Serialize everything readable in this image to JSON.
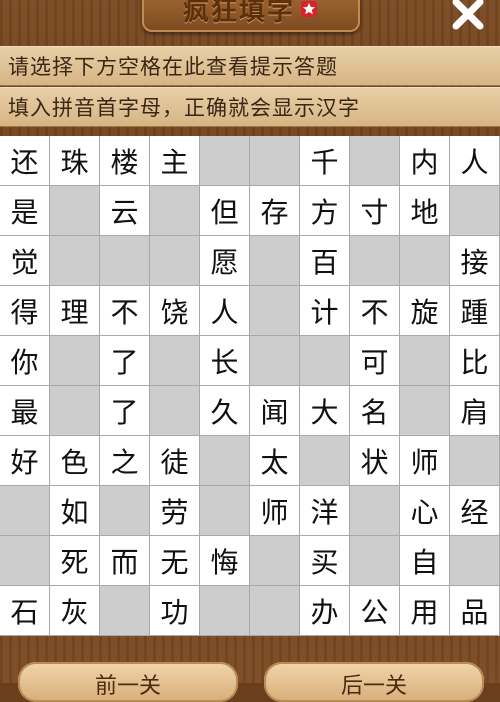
{
  "header": {
    "title": "疯狂填字",
    "close_symbol": "✕"
  },
  "hints": [
    "请选择下方空格在此查看提示答题",
    "填入拼音首字母，正确就会显示汉字"
  ],
  "grid": [
    [
      "还",
      "珠",
      "楼",
      "主",
      "",
      "",
      "千",
      "",
      "内",
      "人"
    ],
    [
      "是",
      "",
      "云",
      "",
      "但",
      "存",
      "方",
      "寸",
      "地",
      ""
    ],
    [
      "觉",
      "",
      "",
      "",
      "愿",
      "",
      "百",
      "",
      "",
      "接"
    ],
    [
      "得",
      "理",
      "不",
      "饶",
      "人",
      "",
      "计",
      "不",
      "旋",
      "踵"
    ],
    [
      "你",
      "",
      "了",
      "",
      "长",
      "",
      "",
      "可",
      "",
      "比"
    ],
    [
      "最",
      "",
      "了",
      "",
      "久",
      "闻",
      "大",
      "名",
      "",
      "肩"
    ],
    [
      "好",
      "色",
      "之",
      "徒",
      "",
      "太",
      "",
      "状",
      "师",
      ""
    ],
    [
      "",
      "如",
      "",
      "劳",
      "",
      "师",
      "洋",
      "",
      "心",
      "经"
    ],
    [
      "",
      "死",
      "而",
      "无",
      "悔",
      "",
      "买",
      "",
      "自",
      ""
    ],
    [
      "石",
      "灰",
      "",
      "功",
      "",
      "",
      "办",
      "公",
      "用",
      "品"
    ]
  ],
  "buttons": {
    "prev": "前一关",
    "next": "后一关"
  },
  "colors": {
    "cell_filled": "#ffffff",
    "cell_empty": "#cdcdcd"
  }
}
